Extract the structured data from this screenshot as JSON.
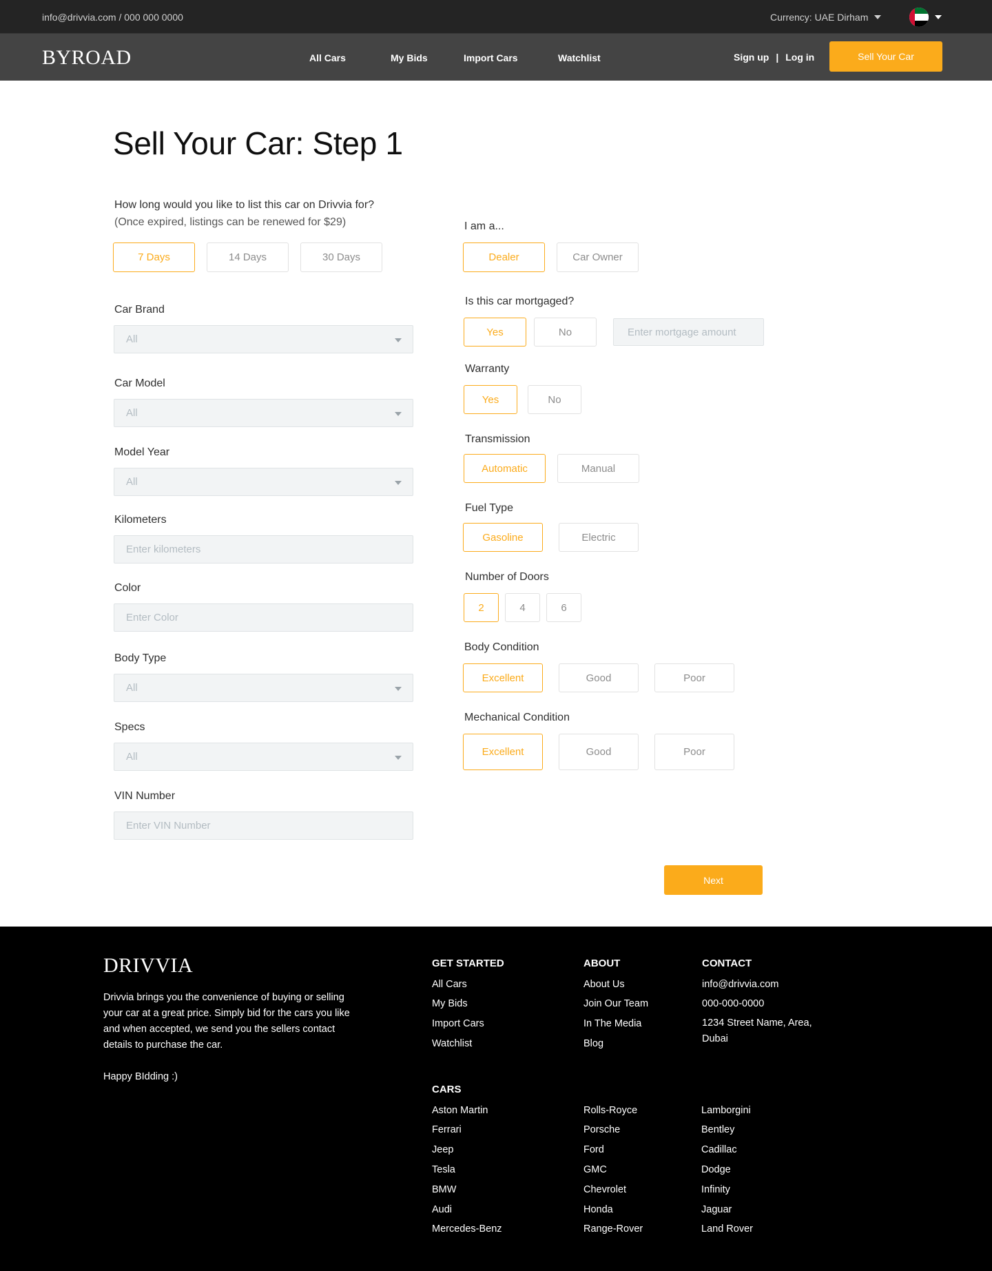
{
  "topbar": {
    "contact": "info@drivvia.com / 000 000 0000",
    "currency": "Currency: UAE Dirham"
  },
  "navbar": {
    "logo": "BYROAD",
    "links": [
      "All Cars",
      "My Bids",
      "Import Cars",
      "Watchlist"
    ],
    "sign_up": "Sign up",
    "separator": "|",
    "log_in": "Log in",
    "sell_button": "Sell Your Car"
  },
  "main": {
    "title": "Sell Your Car: Step 1",
    "listing": {
      "question": "How long would you like to list this car on Drivvia for?",
      "note": "(Once expired, listings can be renewed for $29)",
      "options": [
        "7 Days",
        "14 Days",
        "30 Days"
      ],
      "selected": "7 Days"
    },
    "car_brand": {
      "label": "Car Brand",
      "value": "All"
    },
    "car_model": {
      "label": "Car Model",
      "value": "All"
    },
    "model_year": {
      "label": "Model Year",
      "value": "All"
    },
    "kilometers": {
      "label": "Kilometers",
      "placeholder": "Enter kilometers"
    },
    "color": {
      "label": "Color",
      "placeholder": "Enter Color"
    },
    "body_type": {
      "label": "Body Type",
      "value": "All"
    },
    "specs": {
      "label": "Specs",
      "value": "All"
    },
    "vin": {
      "label": "VIN Number",
      "placeholder": "Enter VIN Number"
    },
    "seller_type": {
      "label": "I am a...",
      "options": [
        "Dealer",
        "Car Owner"
      ],
      "selected": "Dealer"
    },
    "mortgaged": {
      "label": "Is this car mortgaged?",
      "options": [
        "Yes",
        "No"
      ],
      "selected": "Yes",
      "amount_placeholder": "Enter mortgage amount"
    },
    "warranty": {
      "label": "Warranty",
      "options": [
        "Yes",
        "No"
      ],
      "selected": "Yes"
    },
    "transmission": {
      "label": "Transmission",
      "options": [
        "Automatic",
        "Manual"
      ],
      "selected": "Automatic"
    },
    "fuel_type": {
      "label": "Fuel Type",
      "options": [
        "Gasoline",
        "Electric"
      ],
      "selected": "Gasoline"
    },
    "doors": {
      "label": "Number of Doors",
      "options": [
        "2",
        "4",
        "6"
      ],
      "selected": "2"
    },
    "body_condition": {
      "label": "Body Condition",
      "options": [
        "Excellent",
        "Good",
        "Poor"
      ],
      "selected": "Excellent"
    },
    "mechanical_condition": {
      "label": "Mechanical Condition",
      "options": [
        "Excellent",
        "Good",
        "Poor"
      ],
      "selected": "Excellent"
    },
    "next_button": "Next"
  },
  "footer": {
    "logo": "DRIVVIA",
    "description": "Drivvia brings you the convenience of buying or selling your car at a great price. Simply bid for the cars you like and when accepted, we send you the sellers contact details to purchase the car.",
    "tagline": "Happy BIdding :)",
    "get_started": {
      "heading": "GET STARTED",
      "links": [
        "All Cars",
        "My Bids",
        "Import Cars",
        "Watchlist"
      ]
    },
    "about": {
      "heading": "ABOUT",
      "links": [
        "About Us",
        "Join Our Team",
        "In The Media",
        "Blog"
      ]
    },
    "contact": {
      "heading": "CONTACT",
      "email": "info@drivvia.com",
      "phone": "000-000-0000",
      "address": "1234 Street Name, Area, Dubai"
    },
    "cars": {
      "heading": "CARS",
      "col1": [
        "Aston Martin",
        "Ferrari",
        "Jeep",
        "Tesla",
        "BMW",
        "Audi",
        "Mercedes-Benz"
      ],
      "col2": [
        "Rolls-Royce",
        "Porsche",
        "Ford",
        "GMC",
        "Chevrolet",
        "Honda",
        "Range-Rover"
      ],
      "col3": [
        "Lamborgini",
        "Bentley",
        "Cadillac",
        "Dodge",
        "Infinity",
        "Jaguar",
        "Land Rover"
      ]
    }
  },
  "colors": {
    "accent": "#fbab1b",
    "topbar": "#242424",
    "navbar": "#444444",
    "footer": "#000000",
    "field_bg": "#f2f4f5"
  }
}
